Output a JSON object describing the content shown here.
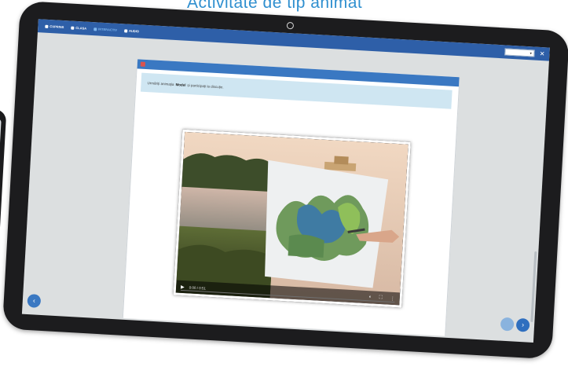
{
  "caption": "Activitate de tip animat",
  "menu": [
    {
      "label": "CUPRINS"
    },
    {
      "label": "CLASA"
    },
    {
      "label": "INTERACTIV"
    },
    {
      "label": "AUDIO"
    }
  ],
  "page_indicator": "",
  "zoom": {
    "value": "",
    "options": []
  },
  "activity": {
    "title": "",
    "instruction_pre": "Urmăriți animația",
    "instruction_bold": "Model",
    "instruction_post": "și participați la discuție."
  },
  "video": {
    "time": "0:00 / 0:51",
    "progress": 0.0
  },
  "nav": {
    "prev": "‹",
    "next": "›",
    "middle": ""
  },
  "colors": {
    "accent": "#2e5fa8",
    "activity_bar": "#3a78c2",
    "instruction_bg": "#cfe6f2",
    "caption": "#2f8fcf"
  }
}
